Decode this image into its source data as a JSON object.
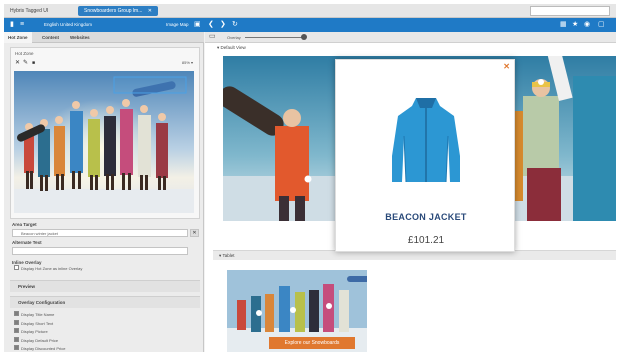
{
  "tabs": [
    {
      "label": "Hybris Tagged UI"
    },
    {
      "label": "Snowboarders Group lm..."
    }
  ],
  "toolbar": {
    "site": "English United Kingdom",
    "image_map": "Image Map"
  },
  "left": {
    "tabs": [
      "Hot Zone",
      "Content",
      "Websites"
    ],
    "hot_zone_title": "Hot Zone",
    "zoom": "85% ▾",
    "area_target_label": "Area Target",
    "area_target_value": "Beacon winter jacket",
    "alt_text_label": "Alternate Text",
    "inline_overlay_label": "Inline Overlay",
    "inline_overlay_check": "Display Hot Zone as inline Overlay",
    "preview_label": "Preview",
    "overlay_config_label": "Overlay Configuration",
    "options": [
      {
        "label": "Display Title Name",
        "checked": true
      },
      {
        "label": "Display Short Text",
        "checked": true
      },
      {
        "label": "Display Picture",
        "checked": true
      },
      {
        "label": "Display Default Price",
        "checked": true
      },
      {
        "label": "Display Discounted Price",
        "checked": true
      },
      {
        "label": "Display Link to Unavailable Product",
        "checked": false
      }
    ]
  },
  "right": {
    "slider_label": "Overlay",
    "default_view": "Default View",
    "folded_label": "Tablet",
    "caption": "Explore our Snowboards"
  },
  "popup": {
    "name": "BEACON JACKET",
    "price": "£101.21"
  }
}
